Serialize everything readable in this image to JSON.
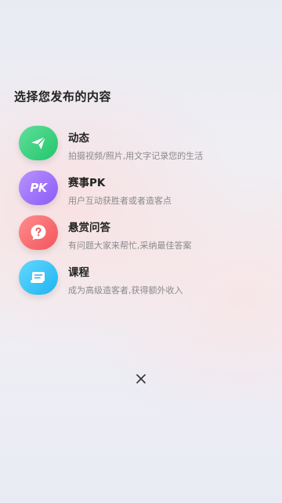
{
  "page": {
    "title": "选择您发布的内容"
  },
  "options": [
    {
      "label": "动态",
      "desc": "拍摄视频/照片,用文字记录您的生活",
      "icon": "paper-plane-icon",
      "color": "#2ecf78"
    },
    {
      "label": "赛事PK",
      "desc": "用户互动获胜者或者造客点",
      "icon": "pk-icon",
      "icon_text": "PK",
      "color": "#9b6cf7"
    },
    {
      "label": "悬赏问答",
      "desc": "有问题大家来帮忙,采纳最佳答案",
      "icon": "question-icon",
      "color": "#f45f66"
    },
    {
      "label": "课程",
      "desc": "成为高级造客者,获得额外收入",
      "icon": "course-scroll-icon",
      "color": "#2cbdf4"
    }
  ],
  "close": {
    "icon": "close-icon"
  }
}
